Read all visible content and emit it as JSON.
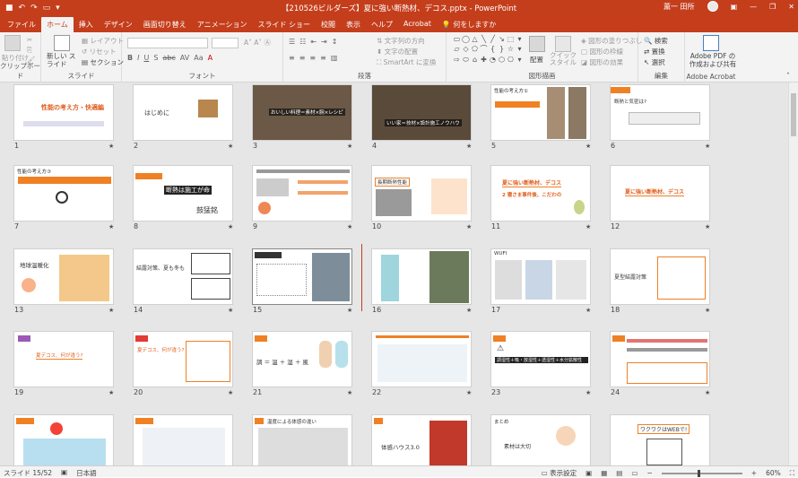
{
  "window": {
    "title": "【210526ビルダーズ】夏に強い断熱材、デコス.pptx  -  PowerPoint",
    "user": "薫一 田所"
  },
  "tabs": [
    "ファイル",
    "ホーム",
    "挿入",
    "デザイン",
    "画面切り替え",
    "アニメーション",
    "スライド ショー",
    "校閲",
    "表示",
    "ヘルプ",
    "Acrobat",
    "何をしますか"
  ],
  "ribbon": {
    "clipboard": {
      "label": "クリップボード",
      "paste": "貼り付け"
    },
    "slides": {
      "label": "スライド",
      "new_slide": "新しい スライド",
      "layout": "レイアウト",
      "reset": "リセット",
      "section": "セクション"
    },
    "font": {
      "label": "フォント"
    },
    "paragraph": {
      "label": "段落",
      "text_direction": "文字列の方向",
      "align_text": "文字の配置",
      "smartart": "SmartArt に変換"
    },
    "drawing": {
      "label": "図形描画",
      "arrange": "配置",
      "quick_styles": "クイック スタイル",
      "shape_fill": "図形の塗りつぶし",
      "shape_outline": "図形の枠線",
      "shape_effects": "図形の効果"
    },
    "editing": {
      "label": "編集",
      "find": "検索",
      "replace": "置換",
      "select": "選択"
    },
    "acrobat": {
      "label": "Adobe Acrobat",
      "create_pdf": "Adobe PDF の 作成および共有"
    }
  },
  "slides": [
    {
      "num": "1",
      "title": "性能の考え方・快適編"
    },
    {
      "num": "2",
      "title": "はじめに"
    },
    {
      "num": "3",
      "title": "おいしい料理＝素材×腕×レシピ"
    },
    {
      "num": "4",
      "title": "いい家＝技材×設計施工ノウハウ"
    },
    {
      "num": "5",
      "title": "性能の考え方①"
    },
    {
      "num": "6",
      "title": "断熱と気密は?"
    },
    {
      "num": "7",
      "title": "性能の考え方③"
    },
    {
      "num": "8",
      "title": "断熱は施工が命"
    },
    {
      "num": "9",
      "title": ""
    },
    {
      "num": "10",
      "title": "長期断熱性能"
    },
    {
      "num": "11",
      "title": "夏に強い断熱材、デコス"
    },
    {
      "num": "12",
      "title": "夏に強い断熱材、デコス"
    },
    {
      "num": "13",
      "title": "地球温暖化"
    },
    {
      "num": "14",
      "title": "結露対策、夏も冬も"
    },
    {
      "num": "15",
      "title": ""
    },
    {
      "num": "16",
      "title": ""
    },
    {
      "num": "17",
      "title": "WUFI"
    },
    {
      "num": "18",
      "title": "夏型結露対策"
    },
    {
      "num": "19",
      "title": "夏デコス、何が違う?"
    },
    {
      "num": "20",
      "title": "夏デコス、何が違う?"
    },
    {
      "num": "21",
      "title": ""
    },
    {
      "num": "22",
      "title": ""
    },
    {
      "num": "23",
      "title": "調湿性＋吸・放湿性＋透湿性＋水分拡散性"
    },
    {
      "num": "24",
      "title": ""
    },
    {
      "num": "25",
      "title": ""
    },
    {
      "num": "26",
      "title": ""
    },
    {
      "num": "27",
      "title": "温度による体感の違い"
    },
    {
      "num": "28",
      "title": "体感ハウス3.0"
    },
    {
      "num": "29",
      "title": "素材は大切"
    },
    {
      "num": "30",
      "title": "ワクワクはWEBで!"
    }
  ],
  "status": {
    "slide_info": "スライド 15/52",
    "language": "日本語",
    "display_settings": "表示設定",
    "zoom": "60%"
  }
}
